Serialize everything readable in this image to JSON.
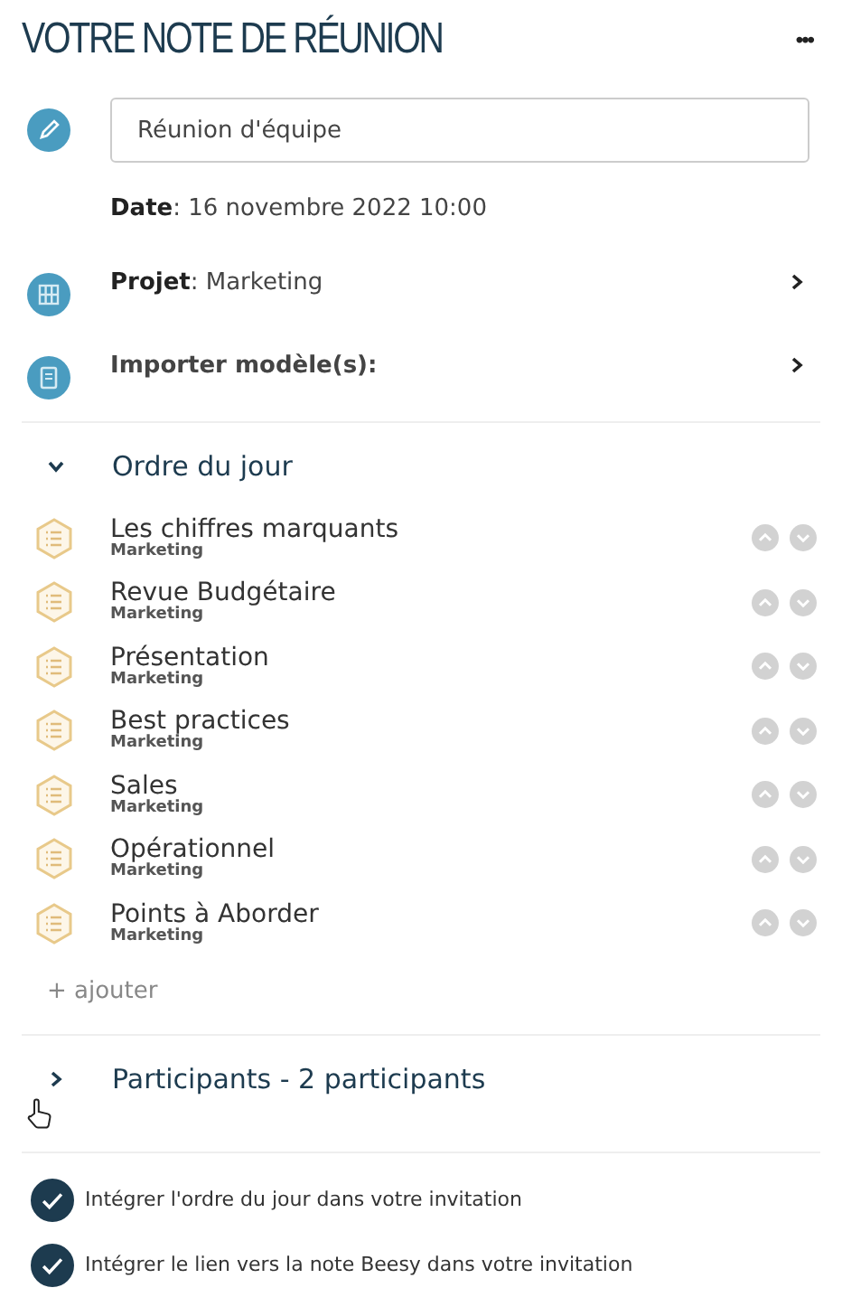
{
  "header": {
    "title": "VOTRE NOTE DE RÉUNION",
    "menu": "•••"
  },
  "meeting": {
    "title_value": "Réunion d'équipe",
    "date": "**Date**: 16 novembre 2022 10:00",
    "project": "**Projet**: Marketing",
    "import_label": "Importer modèle(s):"
  },
  "agenda": {
    "title": "Ordre du jour",
    "expanded": true,
    "items": [
      {
        "title": "Les chiffres marquants",
        "subtitle": "Marketing"
      },
      {
        "title": "Revue Budgétaire",
        "subtitle": "Marketing"
      },
      {
        "title": "Présentation",
        "subtitle": "Marketing"
      },
      {
        "title": "Best practices",
        "subtitle": "Marketing"
      },
      {
        "title": "Sales",
        "subtitle": "Marketing"
      },
      {
        "title": "Opérationnel",
        "subtitle": "Marketing"
      },
      {
        "title": "Points à Aborder",
        "subtitle": "Marketing"
      }
    ],
    "add": "+ ajouter"
  },
  "participants": {
    "title": "Participants - 2 participants",
    "expanded": false
  },
  "options": [
    {
      "label": "Intégrer l'ordre du jour dans votre invitation",
      "checked": true
    },
    {
      "label": "Intégrer le lien vers la note Beesy dans votre invitation",
      "checked": true
    }
  ]
}
